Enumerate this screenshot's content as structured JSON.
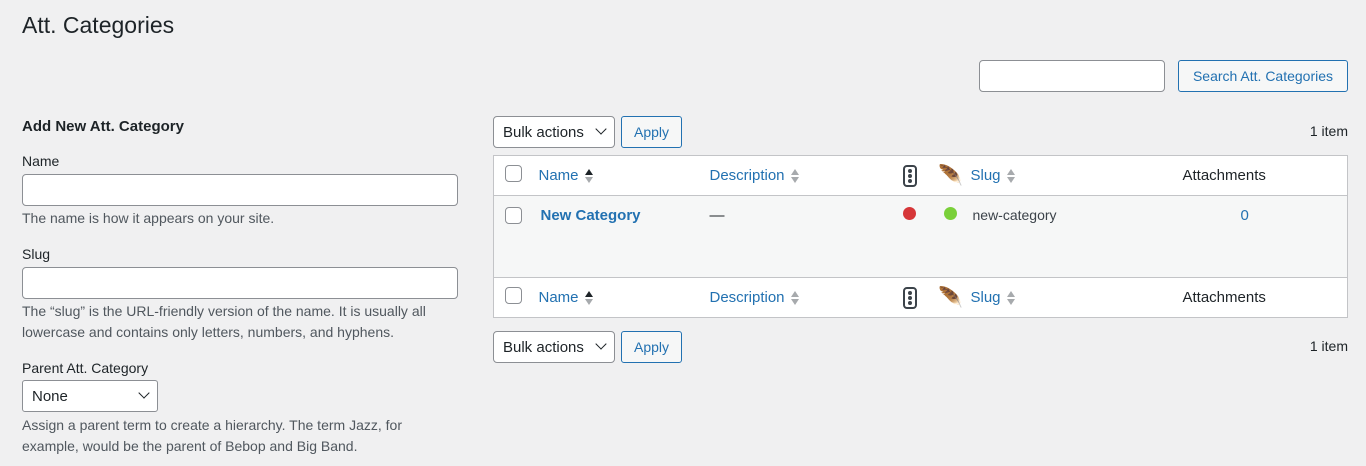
{
  "page_title": "Att. Categories",
  "search": {
    "value": "",
    "button": "Search Att. Categories"
  },
  "form": {
    "heading": "Add New Att. Category",
    "name_label": "Name",
    "name_value": "",
    "name_help": "The name is how it appears on your site.",
    "slug_label": "Slug",
    "slug_value": "",
    "slug_help_1": "The “slug” is the URL-friendly version of the name. It is usually all",
    "slug_help_2": "lowercase and contains only letters, numbers, and hyphens.",
    "parent_label": "Parent Att. Category",
    "parent_value": "None",
    "parent_help_1": "Assign a parent term to create a hierarchy. The term Jazz, for",
    "parent_help_2": "example, would be the parent of Bebop and Big Band."
  },
  "bulk": {
    "label": "Bulk actions",
    "apply": "Apply",
    "count": "1 item"
  },
  "columns": {
    "name": "Name",
    "description": "Description",
    "slug": "Slug",
    "attachments": "Attachments"
  },
  "rows": [
    {
      "name": "New Category",
      "description": "—",
      "status_color": "#d63638",
      "feather_color": "#7ad03a",
      "slug": "new-category",
      "attachments": "0"
    }
  ]
}
